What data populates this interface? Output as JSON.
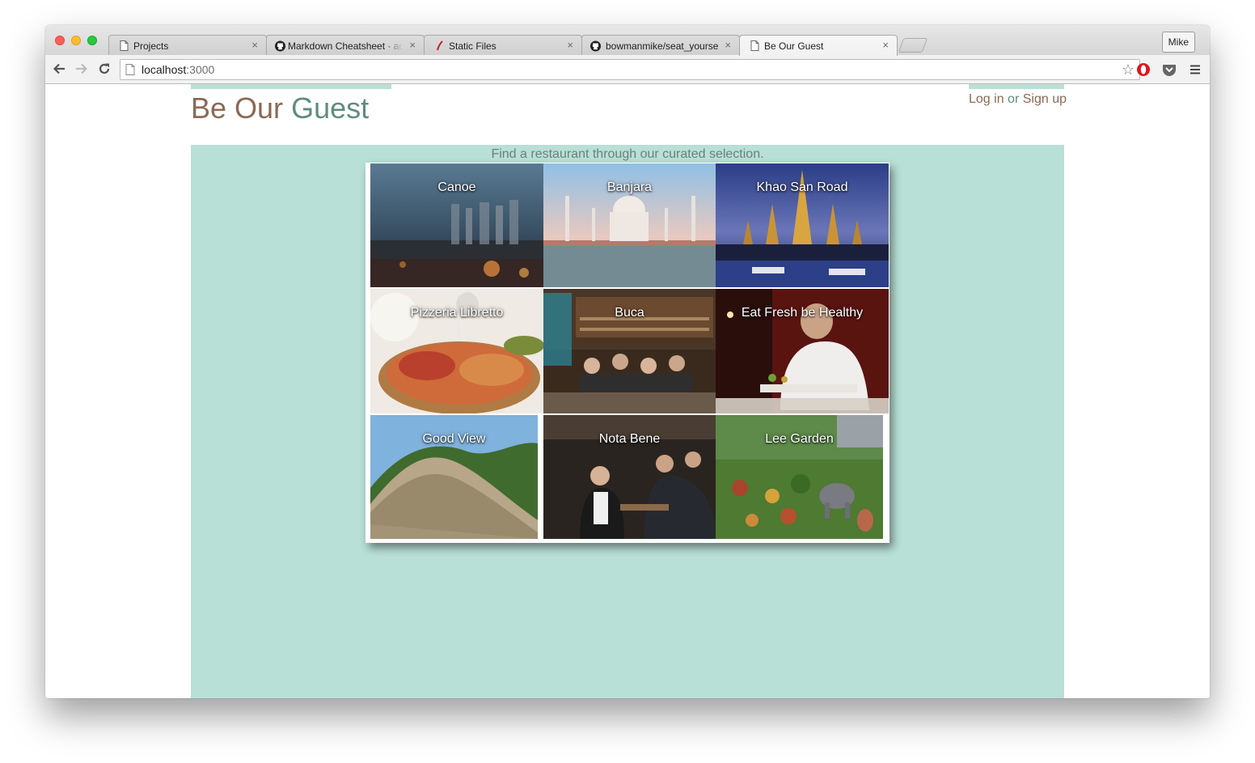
{
  "browser": {
    "tabs": [
      {
        "title": "Projects",
        "icon": "page-icon",
        "active": false
      },
      {
        "title": "Markdown Cheatsheet · ad",
        "icon": "github-icon",
        "active": false
      },
      {
        "title": "Static Files",
        "icon": "rails-icon",
        "active": false
      },
      {
        "title": "bowmanmike/seat_yourself",
        "icon": "github-icon",
        "active": false
      },
      {
        "title": "Be Our Guest",
        "icon": "page-icon",
        "active": true
      }
    ],
    "profile_name": "Mike",
    "url_host": "localhost",
    "url_port": ":3000",
    "close_glyph": "×",
    "star_glyph": "☆"
  },
  "site": {
    "brand_part1": "Be Our ",
    "brand_part2": "Guest",
    "login": "Log in",
    "or": " or ",
    "signup": "Sign up",
    "tagline": "Find a restaurant through our curated selection."
  },
  "restaurants": [
    {
      "name": "Canoe",
      "scene": "city-dusk"
    },
    {
      "name": "Banjara",
      "scene": "taj-mahal"
    },
    {
      "name": "Khao San Road",
      "scene": "temple-night"
    },
    {
      "name": "Pizzeria Libretto",
      "scene": "pizza-plate"
    },
    {
      "name": "Buca",
      "scene": "kitchen-bar"
    },
    {
      "name": "Eat Fresh be Healthy",
      "scene": "chef-red"
    },
    {
      "name": "Good View",
      "scene": "great-wall"
    },
    {
      "name": "Nota Bene",
      "scene": "bartender"
    },
    {
      "name": "Lee Garden",
      "scene": "garden"
    }
  ],
  "colors": {
    "brand_brown": "#8a6a55",
    "brand_green": "#5f8c80",
    "content_bg": "#b8e0d6"
  }
}
